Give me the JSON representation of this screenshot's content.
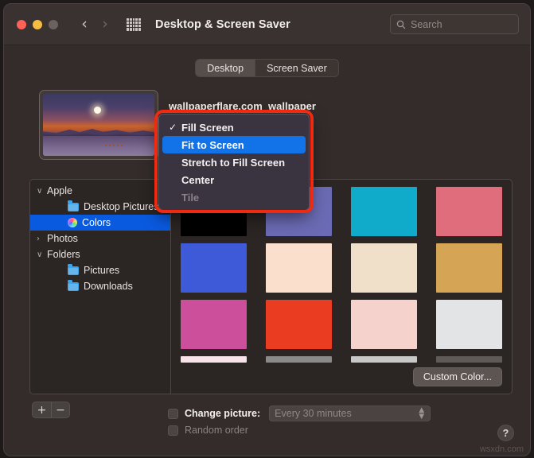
{
  "window": {
    "title": "Desktop & Screen Saver",
    "traffic_lights": [
      "close-red",
      "minimize-yellow",
      "zoom-gray"
    ],
    "nav_back": "‹",
    "nav_forward": "›",
    "grid_icon": "all-preferences-grid"
  },
  "search": {
    "placeholder": "Search",
    "icon": "search-icon"
  },
  "tabs": [
    {
      "label": "Desktop",
      "active": true
    },
    {
      "label": "Screen Saver",
      "active": false
    }
  ],
  "preview": {
    "picture_name": "wallpaperflare.com_wallpaper",
    "thumbnail_alt": "sunset-mountains-lake-wallpaper"
  },
  "scaling_menu": {
    "open": true,
    "items": [
      {
        "label": "Fill Screen",
        "checked": true,
        "highlighted": false,
        "disabled": false
      },
      {
        "label": "Fit to Screen",
        "checked": false,
        "highlighted": true,
        "disabled": false
      },
      {
        "label": "Stretch to Fill Screen",
        "checked": false,
        "highlighted": false,
        "disabled": false
      },
      {
        "label": "Center",
        "checked": false,
        "highlighted": false,
        "disabled": false
      },
      {
        "label": "Tile",
        "checked": false,
        "highlighted": false,
        "disabled": true
      }
    ],
    "checkmark": "✓"
  },
  "sidebar": {
    "items": [
      {
        "label": "Apple",
        "level": 0,
        "disclosure": "∨",
        "icon": null,
        "selected": false
      },
      {
        "label": "Desktop Pictures",
        "level": 1,
        "disclosure": null,
        "icon": "folder-icon",
        "selected": false
      },
      {
        "label": "Colors",
        "level": 1,
        "disclosure": null,
        "icon": "color-wheel-icon",
        "selected": true
      },
      {
        "label": "Photos",
        "level": 0,
        "disclosure": "›",
        "icon": null,
        "selected": false
      },
      {
        "label": "Folders",
        "level": 0,
        "disclosure": "∨",
        "icon": null,
        "selected": false
      },
      {
        "label": "Pictures",
        "level": 1,
        "disclosure": null,
        "icon": "folder-icon",
        "selected": false
      },
      {
        "label": "Downloads",
        "level": 1,
        "disclosure": null,
        "icon": "folder-icon",
        "selected": false
      }
    ]
  },
  "swatches": {
    "rows": [
      {
        "partial": false,
        "colors": [
          "#000000",
          "#6b6bb5",
          "#10abcb",
          "#df6d7b"
        ]
      },
      {
        "partial": false,
        "colors": [
          "#3f5ad8",
          "#fadfcd",
          "#f0e0ca",
          "#d5a455"
        ]
      },
      {
        "partial": false,
        "colors": [
          "#cc4f9b",
          "#e93c20",
          "#f6d2cd",
          "#e3e4e6"
        ]
      },
      {
        "partial": true,
        "colors": [
          "#f9e3ea",
          "#8a8a8a",
          "#c8c8c8",
          "#5f5a58"
        ]
      }
    ]
  },
  "buttons": {
    "custom_color": "Custom Color...",
    "add": "+",
    "remove": "−",
    "help": "?"
  },
  "change_picture": {
    "label": "Change picture:",
    "checked": false,
    "interval_value": "Every 30 minutes",
    "stepper_icon": "chevron-updown-icon"
  },
  "random_order": {
    "label": "Random order",
    "checked": false
  },
  "watermark": "wsxdn.com",
  "colors": {
    "accent_blue": "#0a5ae0",
    "menu_highlight": "#1272e8",
    "annotation_red": "#f02a10",
    "window_bg": "#332c2a"
  }
}
